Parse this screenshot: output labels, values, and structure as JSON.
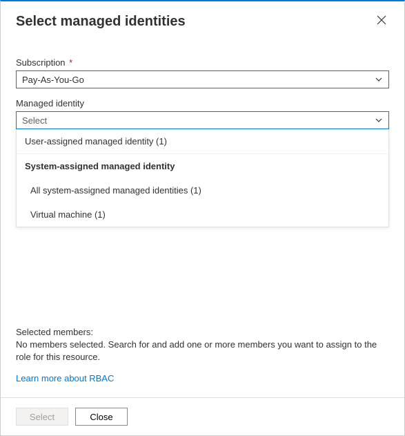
{
  "header": {
    "title": "Select managed identities"
  },
  "fields": {
    "subscription": {
      "label": "Subscription",
      "required_marker": "*",
      "value": "Pay-As-You-Go"
    },
    "managed_identity": {
      "label": "Managed identity",
      "placeholder": "Select"
    }
  },
  "dropdown": {
    "user_assigned": "User-assigned managed identity (1)",
    "system_header": "System-assigned managed identity",
    "all_system": "All system-assigned managed identities (1)",
    "virtual_machine": "Virtual machine (1)"
  },
  "selected": {
    "label": "Selected members:",
    "empty_text": "No members selected. Search for and add one or more members you want to assign to the role for this resource."
  },
  "links": {
    "learn_more": "Learn more about RBAC"
  },
  "footer": {
    "select": "Select",
    "close": "Close"
  }
}
